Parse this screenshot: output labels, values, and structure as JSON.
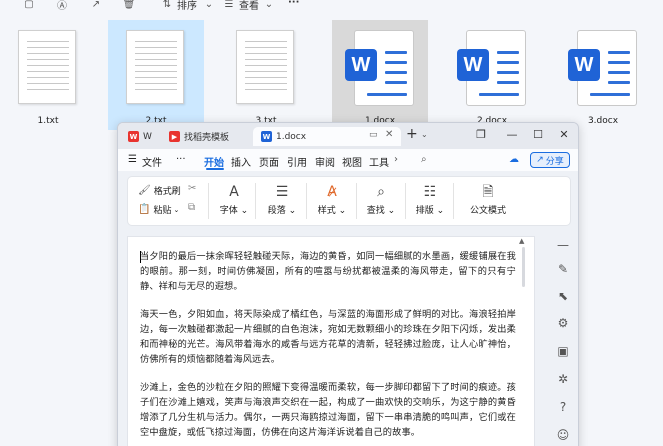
{
  "explorer": {
    "toolbar": {
      "sort_label": "排序",
      "view_label": "查看",
      "more_label": "···"
    },
    "files": [
      {
        "name": "1.txt",
        "type": "txt"
      },
      {
        "name": "2.txt",
        "type": "txt"
      },
      {
        "name": "3.txt",
        "type": "txt"
      },
      {
        "name": "1.docx",
        "type": "docx"
      },
      {
        "name": "2.docx",
        "type": "docx"
      },
      {
        "name": "3.docx",
        "type": "docx"
      }
    ]
  },
  "wps": {
    "tabs": [
      {
        "label": "W"
      },
      {
        "label": "找稻壳模板"
      },
      {
        "label": "1.docx"
      }
    ],
    "add_tab": "+",
    "menu": {
      "file": "文件",
      "more": "···",
      "items": [
        "开始",
        "插入",
        "页面",
        "引用",
        "审阅",
        "视图",
        "工具"
      ],
      "active": "开始",
      "share": "分享"
    },
    "ribbon": {
      "format_painter": "格式刷",
      "paste": "粘贴",
      "font": "字体",
      "paragraph": "段落",
      "style": "样式",
      "find": "查找",
      "layout": "排版",
      "official_mode": "公文模式"
    },
    "document": {
      "paragraphs": [
        "当夕阳的最后一抹余晖轻轻触碰天际，海边的黄昏，如同一幅细腻的水墨画，缓缓铺展在我的眼前。那一刻，时间仿佛凝固，所有的喧嚣与纷扰都被温柔的海风带走，留下的只有宁静、祥和与无尽的遐想。",
        "海天一色，夕阳如血，将天际染成了橘红色，与深蓝的海面形成了鲜明的对比。海浪轻拍岸边，每一次触碰都激起一片细腻的白色泡沫，宛如无数颗细小的珍珠在夕阳下闪烁，发出柔和而神秘的光芒。海风带着海水的咸香与远方花草的清新，轻轻拂过脸庞，让人心旷神怡，仿佛所有的烦恼都随着海风远去。",
        "沙滩上，金色的沙粒在夕阳的照耀下变得温暖而柔软，每一步脚印都留下了时间的痕迹。孩子们在沙滩上嬉戏，笑声与海浪声交织在一起，构成了一曲欢快的交响乐，为这宁静的黄昏增添了几分生机与活力。偶尔，一两只海鸥掠过海面，留下一串串清脆的鸣叫声，它们或在空中盘旋，或低飞掠过海面，仿佛在向这片海洋诉说着自己的故事。"
      ]
    }
  }
}
